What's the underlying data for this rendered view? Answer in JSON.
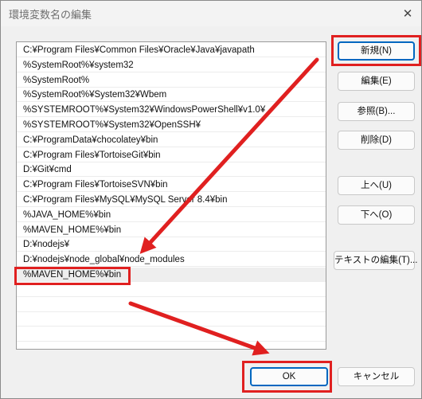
{
  "dialog": {
    "title": "環境変数名の編集",
    "close_glyph": "✕"
  },
  "list": {
    "items": [
      "C:¥Program Files¥Common Files¥Oracle¥Java¥javapath",
      "%SystemRoot%¥system32",
      "%SystemRoot%",
      "%SystemRoot%¥System32¥Wbem",
      "%SYSTEMROOT%¥System32¥WindowsPowerShell¥v1.0¥",
      "%SYSTEMROOT%¥System32¥OpenSSH¥",
      "C:¥ProgramData¥chocolatey¥bin",
      "C:¥Program Files¥TortoiseGit¥bin",
      "D:¥Git¥cmd",
      "C:¥Program Files¥TortoiseSVN¥bin",
      "C:¥Program Files¥MySQL¥MySQL Server 8.4¥bin",
      "%JAVA_HOME%¥bin",
      "%MAVEN_HOME%¥bin",
      "D:¥nodejs¥",
      "D:¥nodejs¥node_global¥node_modules",
      "%MAVEN_HOME%¥bin",
      "",
      "",
      "",
      "",
      ""
    ],
    "selected_index": 15
  },
  "buttons": {
    "new": "新規(N)",
    "edit": "編集(E)",
    "browse": "参照(B)...",
    "delete": "削除(D)",
    "up": "上へ(U)",
    "down": "下へ(O)",
    "edit_text": "テキストの編集(T)...",
    "ok": "OK",
    "cancel": "キャンセル"
  },
  "annotation": {
    "color": "#e02020"
  }
}
